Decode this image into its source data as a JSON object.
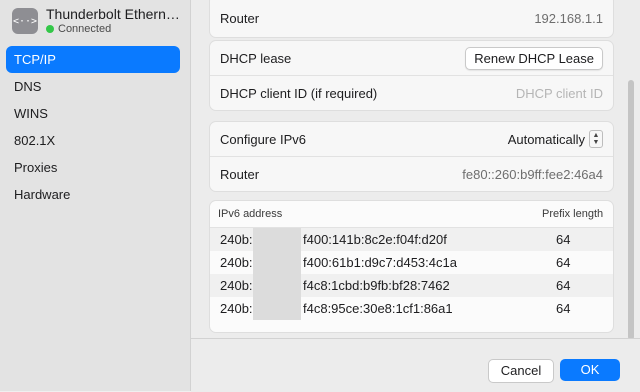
{
  "sidebar": {
    "service": {
      "name": "Thunderbolt Ethern…",
      "status": "Connected",
      "icon": "network-arrows-icon"
    },
    "items": [
      "TCP/IP",
      "DNS",
      "WINS",
      "802.1X",
      "Proxies",
      "Hardware"
    ],
    "active": "TCP/IP"
  },
  "ipv4": {
    "router_label": "Router",
    "router_value": "192.168.1.1"
  },
  "dhcp": {
    "lease_label": "DHCP lease",
    "renew_button": "Renew DHCP Lease",
    "client_id_label": "DHCP client ID (if required)",
    "client_id_placeholder": "DHCP client ID"
  },
  "ipv6": {
    "configure_label": "Configure IPv6",
    "configure_value": "Automatically",
    "router_label": "Router",
    "router_value": "fe80::260:b9ff:fee2:46a4"
  },
  "ipv6_table": {
    "headers": [
      "IPv6 address",
      "Prefix length"
    ],
    "rows": [
      {
        "prefix": "240b:",
        "suffix": "f400:141b:8c2e:f04f:d20f",
        "length": "64"
      },
      {
        "prefix": "240b:",
        "suffix": "f400:61b1:d9c7:d453:4c1a",
        "length": "64"
      },
      {
        "prefix": "240b:",
        "suffix": "f4c8:1cbd:b9fb:bf28:7462",
        "length": "64"
      },
      {
        "prefix": "240b:",
        "suffix": "f4c8:95ce:30e8:1cf1:86a1",
        "length": "64"
      }
    ]
  },
  "footer": {
    "cancel": "Cancel",
    "ok": "OK"
  }
}
